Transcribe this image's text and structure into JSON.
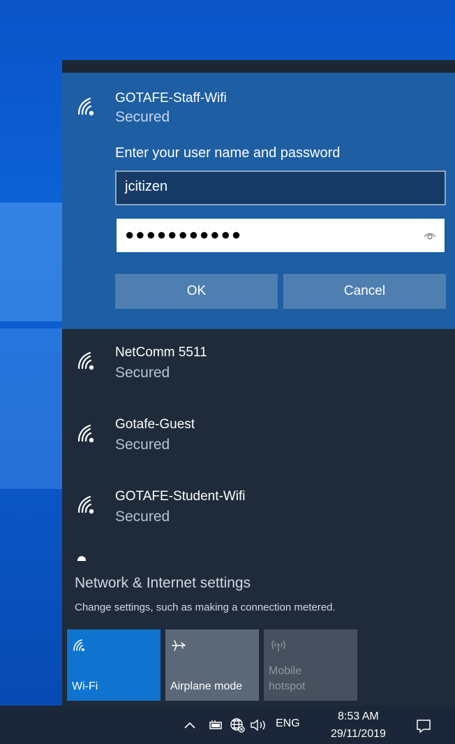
{
  "selected_network": {
    "name": "GOTAFE-Staff-Wifi",
    "status": "Secured",
    "prompt": "Enter your user name and password",
    "username_value": "jcitizen",
    "password_mask": "●●●●●●●●●●●",
    "ok_label": "OK",
    "cancel_label": "Cancel"
  },
  "networks": [
    {
      "name": "NetComm 5511",
      "status": "Secured"
    },
    {
      "name": "Gotafe-Guest",
      "status": "Secured"
    },
    {
      "name": "GOTAFE-Student-Wifi",
      "status": "Secured"
    }
  ],
  "settings": {
    "title": "Network & Internet settings",
    "subtitle": "Change settings, such as making a connection metered."
  },
  "quick_actions": [
    {
      "label": "Wi-Fi",
      "icon": "wifi-icon",
      "state": "on"
    },
    {
      "label": "Airplane mode",
      "icon": "airplane-icon",
      "state": "off"
    },
    {
      "label_line1": "Mobile",
      "label_line2": "hotspot",
      "icon": "hotspot-icon",
      "state": "disabled"
    }
  ],
  "taskbar": {
    "language": "ENG",
    "time": "8:53 AM",
    "date": "29/11/2019",
    "icons": [
      "chevron-up-icon",
      "battery-icon",
      "network-globe-icon",
      "volume-icon",
      "action-center-icon"
    ]
  },
  "colors": {
    "selected_bg": "#1e5ea3",
    "flyout_bg": "#1f2b3b",
    "accent": "#0f74cf",
    "desktop": "#0a54c8"
  }
}
